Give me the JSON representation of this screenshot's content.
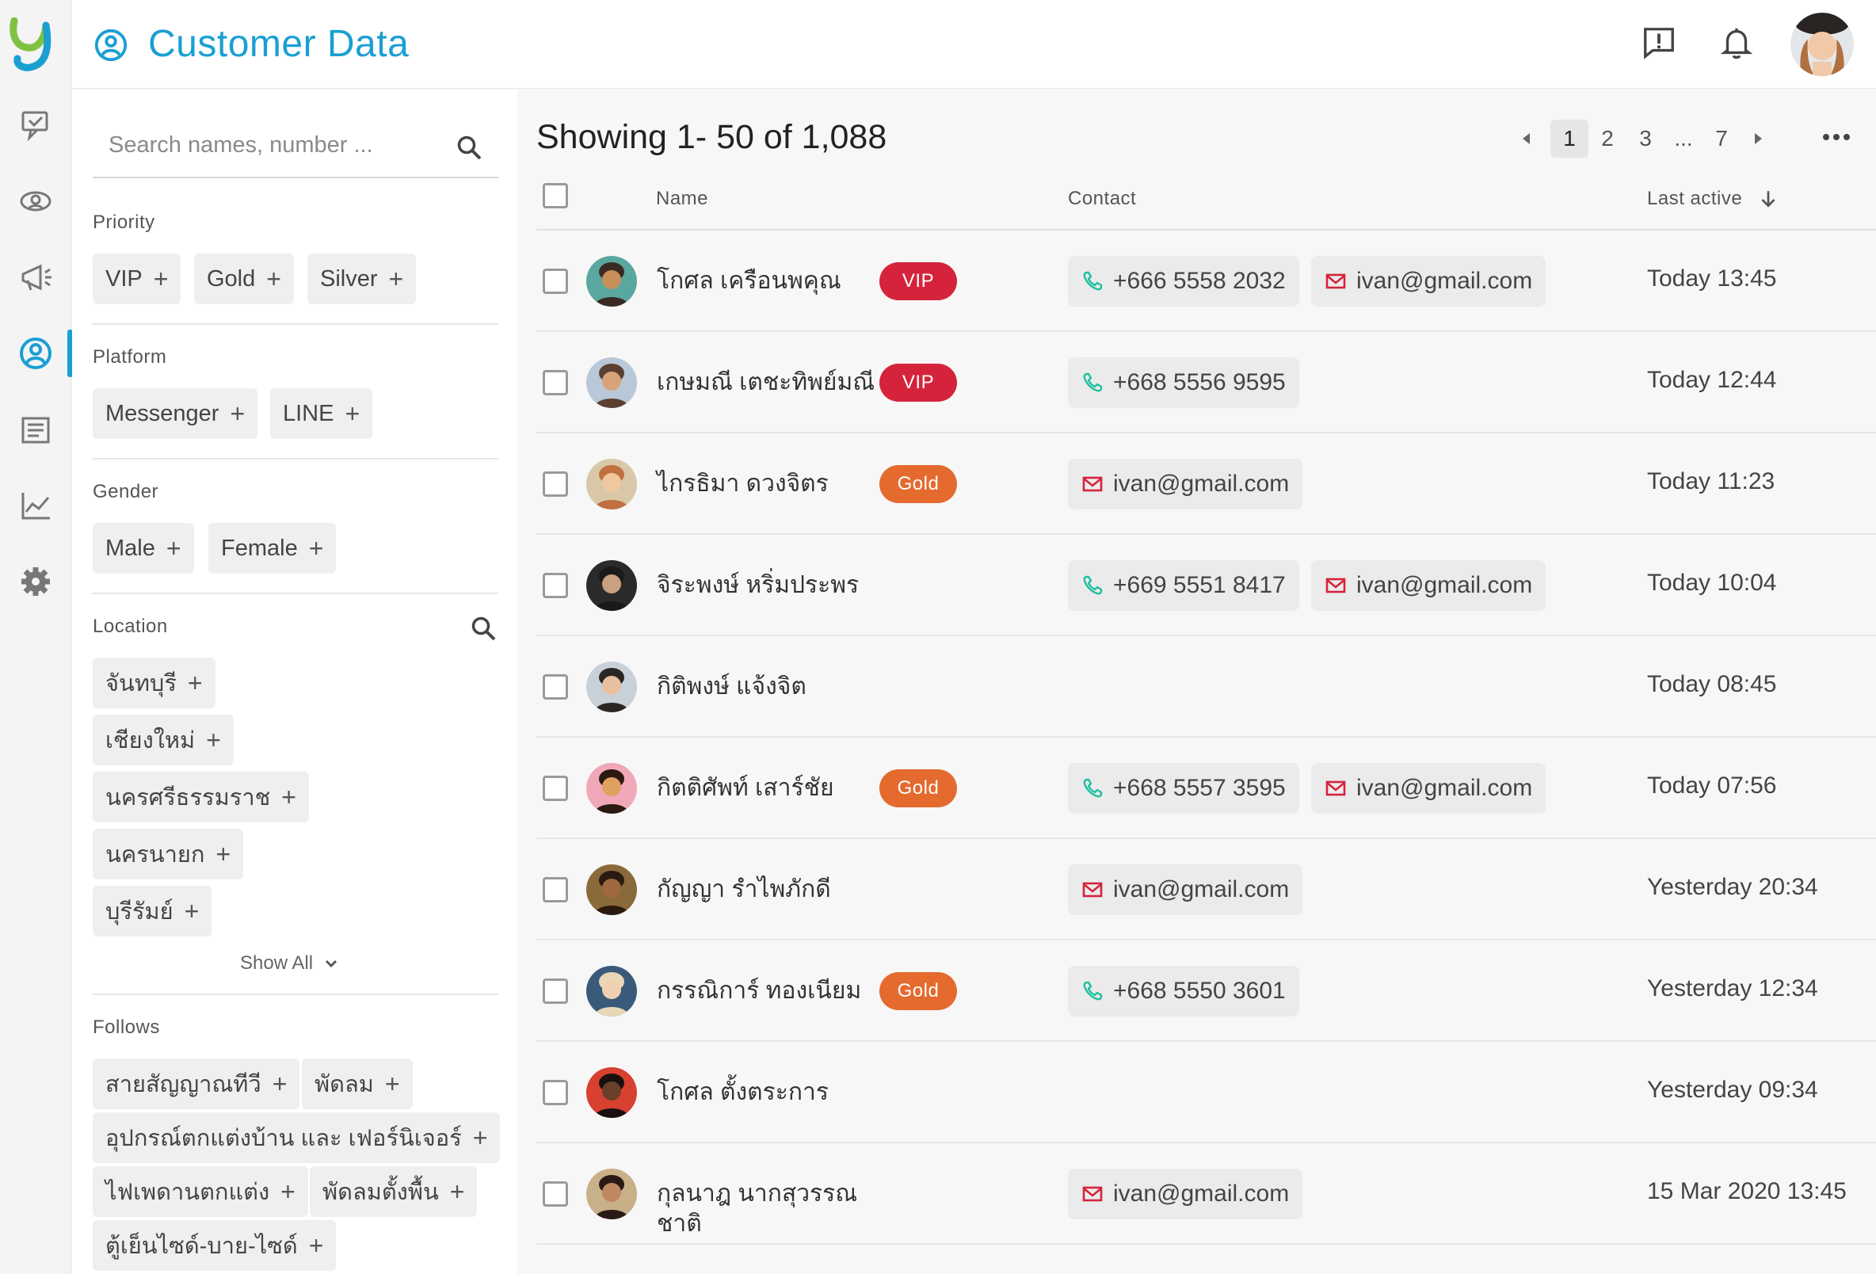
{
  "header": {
    "title": "Customer Data"
  },
  "search": {
    "placeholder": "Search names, number ..."
  },
  "filters": {
    "priority": {
      "title": "Priority",
      "chips": [
        "VIP",
        "Gold",
        "Silver"
      ]
    },
    "platform": {
      "title": "Platform",
      "chips": [
        "Messenger",
        "LINE"
      ]
    },
    "gender": {
      "title": "Gender",
      "chips": [
        "Male",
        "Female"
      ]
    },
    "location": {
      "title": "Location",
      "chips": [
        "จันทบุรี",
        "เชียงใหม่",
        "นครศรีธรรมราช",
        "นครนายก",
        "บุรีรัมย์"
      ],
      "show_all": "Show All"
    },
    "follows": {
      "title": "Follows",
      "chips": [
        "สายสัญญาณทีวี",
        "พัดลม",
        "อุปกรณ์ตกแต่งบ้าน และ เฟอร์นิเจอร์",
        "ไฟเพดานตกแต่ง",
        "พัดลมตั้งพื้น",
        "ตู้เย็นไซด์-บาย-ไซด์"
      ]
    }
  },
  "main": {
    "showing": "Showing 1- 50 of 1,088",
    "pagination": [
      "1",
      "2",
      "3",
      "...",
      "7"
    ],
    "columns": {
      "name": "Name",
      "contact": "Contact",
      "last_active": "Last active"
    }
  },
  "rows": [
    {
      "name": "โกศล เครือนพคุณ",
      "badge": "VIP",
      "phone": "+666 5558 2032",
      "email": "ivan@gmail.com",
      "last_active": "Today 13:45"
    },
    {
      "name": "เกษมณี เตชะทิพย์มณี",
      "badge": "VIP",
      "phone": "+668 5556 9595",
      "email": "",
      "last_active": "Today 12:44"
    },
    {
      "name": "ไกรธิมา ดวงจิตร",
      "badge": "Gold",
      "phone": "",
      "email": "ivan@gmail.com",
      "last_active": "Today 11:23"
    },
    {
      "name": "จิระพงษ์ หริ่มประพร",
      "badge": "",
      "phone": "+669 5551 8417",
      "email": "ivan@gmail.com",
      "last_active": "Today 10:04"
    },
    {
      "name": "กิติพงษ์ แจ้งจิต",
      "badge": "",
      "phone": "",
      "email": "",
      "last_active": "Today 08:45"
    },
    {
      "name": "กิตติศัพท์ เสาร์ชัย",
      "badge": "Gold",
      "phone": "+668 5557 3595",
      "email": "ivan@gmail.com",
      "last_active": "Today 07:56"
    },
    {
      "name": "กัญญา รำไพภักดี",
      "badge": "",
      "phone": "",
      "email": "ivan@gmail.com",
      "last_active": "Yesterday 20:34"
    },
    {
      "name": "กรรณิการ์ ทองเนียม",
      "badge": "Gold",
      "phone": "+668 5550 3601",
      "email": "",
      "last_active": "Yesterday 12:34"
    },
    {
      "name": "โกศล ตั้งตระการ",
      "badge": "",
      "phone": "",
      "email": "",
      "last_active": "Yesterday 09:34"
    },
    {
      "name": "กุลนาฎ นากสุวรรณชาติ",
      "badge": "",
      "phone": "",
      "email": "ivan@gmail.com",
      "last_active": "15 Mar 2020 13:45"
    }
  ],
  "colors": {
    "accent": "#1a9fd3",
    "vip": "#d6233c",
    "gold": "#e46a2e",
    "phone_icon": "#1fbfa0",
    "mail_icon": "#d6233c"
  },
  "icons": {
    "rail": [
      "chat-icon",
      "contacts-icon",
      "broadcast-icon",
      "customer-icon",
      "report-icon",
      "analytics-icon",
      "settings-icon"
    ]
  }
}
